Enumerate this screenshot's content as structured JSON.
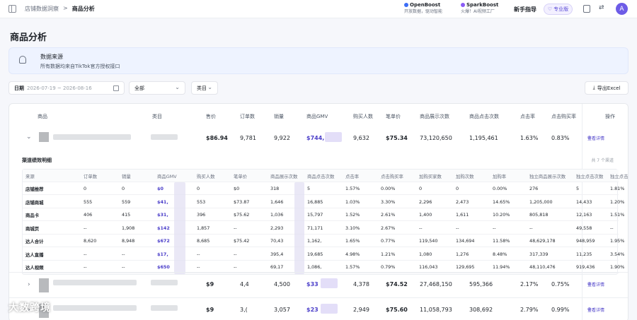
{
  "topbar": {
    "breadcrumbs": [
      "店铺数据洞察",
      ">",
      "商品分析"
    ],
    "openboost": {
      "name": "OpenBoost",
      "tag": "开放数据，驱动智能"
    },
    "sparkboost": {
      "name": "SparkBoost",
      "tag": "火爆！AI视频工厂"
    },
    "guide": "新手指导",
    "pro": "专业版",
    "avatar": "A"
  },
  "page": {
    "title": "商品分析"
  },
  "notice": {
    "title": "数据来源",
    "text": "所有数据均来自TikTok官方授权接口"
  },
  "filters": {
    "date_label": "日期",
    "date_range": "2026-07-19 ~ 2026-08-16",
    "scope": "全部",
    "category": "类目",
    "export": "导出Excel"
  },
  "table": {
    "columns": [
      "商品",
      "类目",
      "售价",
      "订单数",
      "销量",
      "商品GMV",
      "购买人数",
      "笔单价",
      "商品展示次数",
      "商品点击次数",
      "点击率",
      "点击购买率",
      "操作"
    ],
    "detail_label": "查看详情",
    "rows": [
      {
        "price": "$86.94",
        "orders": "9,781",
        "sales": "9,922",
        "gmv": "$744,",
        "buyers": "9,632",
        "aov": "$75.34",
        "impr": "73,120,650",
        "clicks": "1,195,461",
        "ctr": "1.63%",
        "cvr": "0.83%"
      },
      {
        "price": "$9",
        "orders": "4,4",
        "sales": "4,500",
        "gmv": "$33",
        "buyers": "4,378",
        "aov": "$74.52",
        "impr": "27,468,150",
        "clicks": "595,366",
        "ctr": "2.17%",
        "cvr": "0.75%"
      },
      {
        "price": "$9",
        "orders": "3,(",
        "sales": "3,057",
        "gmv": "$23",
        "buyers": "2,949",
        "aov": "$75.60",
        "impr": "11,058,793",
        "clicks": "308,692",
        "ctr": "2.79%",
        "cvr": "0.99%"
      }
    ]
  },
  "channel": {
    "title": "渠道绩效明细",
    "count": "共 7 个渠道",
    "columns": [
      "来源",
      "订单数",
      "销量",
      "商品GMV",
      "购买人数",
      "笔单价",
      "商品展示次数",
      "商品点击次数",
      "点击率",
      "点击购买率",
      "加购买家数",
      "加购次数",
      "加购率",
      "独立商品展示次数",
      "独立点击次数",
      "独立点击"
    ],
    "rows": [
      [
        "店铺推荐",
        "0",
        "0",
        "$0",
        "0",
        "$0",
        "318",
        "5",
        "1.57%",
        "0.00%",
        "0",
        "0",
        "0.00%",
        "276",
        "5",
        "1.81%"
      ],
      [
        "店铺商城",
        "555",
        "559",
        "$41,",
        "553",
        "$73.87",
        "1,646",
        "16,885",
        "1.03%",
        "3.30%",
        "2,296",
        "2,473",
        "14.65%",
        "1,205,000",
        "14,433",
        "1.20%"
      ],
      [
        "商品卡",
        "406",
        "415",
        "$31,",
        "396",
        "$75.62",
        "1,036",
        "15,797",
        "1.52%",
        "2.61%",
        "1,400",
        "1,611",
        "10.20%",
        "805,818",
        "12,163",
        "1.51%"
      ],
      [
        "商城页",
        "--",
        "1,908",
        "$142",
        "1,857",
        "--",
        "2,293",
        "71,171",
        "3.10%",
        "2.67%",
        "--",
        "--",
        "--",
        "--",
        "49,558",
        "--"
      ],
      [
        "达人合计",
        "8,620",
        "8,948",
        "$672",
        "8,685",
        "$75.42",
        "70,43",
        "1,162,",
        "1.65%",
        "0.77%",
        "119,540",
        "134,694",
        "11.58%",
        "48,629,178",
        "948,959",
        "1.95%"
      ],
      [
        "达人直播",
        "--",
        "--",
        "$17,",
        "--",
        "--",
        "395,4",
        "19,685",
        "4.98%",
        "1.21%",
        "1,080",
        "1,276",
        "8.48%",
        "317,339",
        "11,235",
        "3.54%"
      ],
      [
        "达人视频",
        "--",
        "--",
        "$650",
        "--",
        "--",
        "69,17",
        "1,086,",
        "1.57%",
        "0.79%",
        "116,043",
        "129,695",
        "11.94%",
        "48,110,476",
        "919,436",
        "1.90%"
      ]
    ]
  },
  "watermark": "大数跨境"
}
